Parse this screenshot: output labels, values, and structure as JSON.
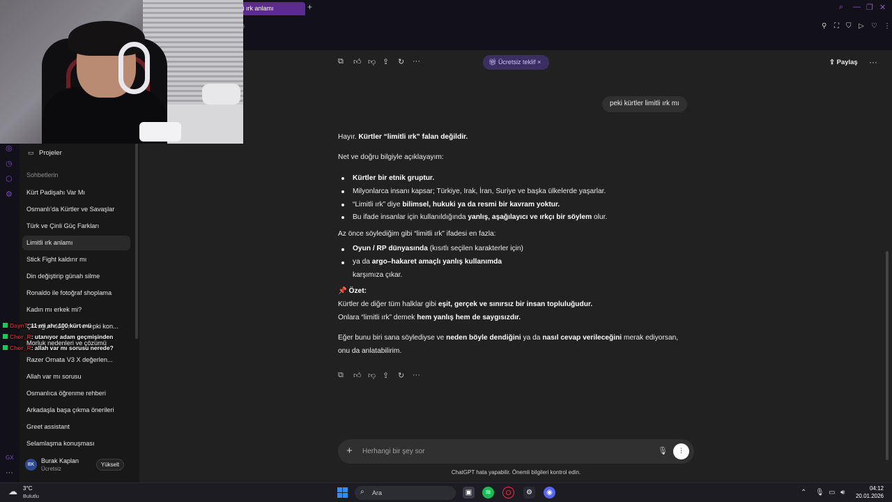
{
  "browser": {
    "tab_title": "tli ırk anlamı",
    "new_tab": "+",
    "url_fragment": "9"
  },
  "header": {
    "offer_label": "Ücretsiz teklif",
    "offer_close": "×",
    "share_label": "Paylaş",
    "more": "···"
  },
  "sidebar": {
    "projects": "Projeler",
    "chats_heading": "Sohbetlerin",
    "items": [
      "Kürt Padişahı Var Mı",
      "Osmanlı'da Kürtler ve Savaşlar",
      "Türk ve Çinli Güç Farkları",
      "Limitli ırk anlamı",
      "Stick Fight kaldırır mı",
      "Din değiştirip günah silme",
      "Ronaldo ile fotoğraf shoplama",
      "Kadın mı erkek mi?",
      "Çocuğun doğumu ve tepki kon...",
      "Morluk nedenleri ve çözümü",
      "Razer Ornata V3 X değerlen...",
      "Allah var mı sorusu",
      "Osmanlıca öğrenme rehberi",
      "Arkadaşla başa çıkma önerileri",
      "Greet assistant",
      "Selamlaşma konuşması"
    ],
    "active_index": 3
  },
  "user": {
    "initials": "BK",
    "name": "Burak Kaplan",
    "plan": "Ücretsiz",
    "upgrade": "Yükselt"
  },
  "stream_chat": [
    {
      "user": "DaynT",
      "message": ": 11 mi ahr 100 kürt mü"
    },
    {
      "user": "Chor_R",
      "message": ": utanıyor adam geçmişinden"
    },
    {
      "user": "Chor_R",
      "message": ": allah var mı sorusu nerede?"
    }
  ],
  "conversation": {
    "user_message": "peki kürtler limitli ırk mı",
    "reply": {
      "l1_plain": "Hayır. ",
      "l1_bold": "Kürtler “limitli ırk” falan değildir.",
      "l2": "Net ve doğru bilgiyle açıklayayım:",
      "b1_bold": "Kürtler bir etnik gruptur.",
      "b2": "Milyonlarca insanı kapsar; Türkiye, Irak, İran, Suriye ve başka ülkelerde yaşarlar.",
      "b3_plain": "“Limitli ırk” diye ",
      "b3_bold": "bilimsel, hukuki ya da resmi bir kavram yoktur.",
      "b4_plain": "Bu ifade insanlar için kullanıldığında ",
      "b4_bold": "yanlış, aşağılayıcı ve ırkçı bir söylem",
      "b4_end": " olur.",
      "l3": "Az önce söylediğim gibi “limitli ırk” ifadesi en fazla:",
      "c1_bold": "Oyun / RP dünyasında",
      "c1_plain": " (kısıtlı seçilen karakterler için)",
      "c2_plain": "ya da ",
      "c2_bold": "argo–hakaret amaçlı yanlış kullanımda",
      "c3": "karşımıza çıkar.",
      "summary_pin": "📌",
      "summary_label": "Özet:",
      "s1_plain": "Kürtler de diğer tüm halklar gibi ",
      "s1_bold": "eşit, gerçek ve sınırsız bir insan topluluğudur.",
      "s2_plain": "Onlara “limitli ırk” demek ",
      "s2_bold": "hem yanlış hem de saygısızdır.",
      "f1_a": "Eğer bunu biri sana söylediyse ve ",
      "f1_b": "neden böyle dendiğini",
      "f1_c": " ya da ",
      "f1_d": "nasıl cevap verileceğini",
      "f1_e": " merak ediyorsan,",
      "f2": "onu da anlatabilirim."
    }
  },
  "composer": {
    "placeholder": "Herhangi bir şey sor",
    "plus": "+",
    "disclaimer": "ChatGPT hata yapabilir. Önemli bilgileri kontrol edin."
  },
  "taskbar": {
    "temperature": "3°C",
    "weather": "Bulutlu",
    "search_label": "Ara",
    "time": "04:12",
    "date": "20.01.2026"
  },
  "colors": {
    "accent": "#7a4fc4",
    "offer_bg": "#3b2f61",
    "chat_user": "#c02a2a",
    "chat_badge": "#21c45a"
  }
}
